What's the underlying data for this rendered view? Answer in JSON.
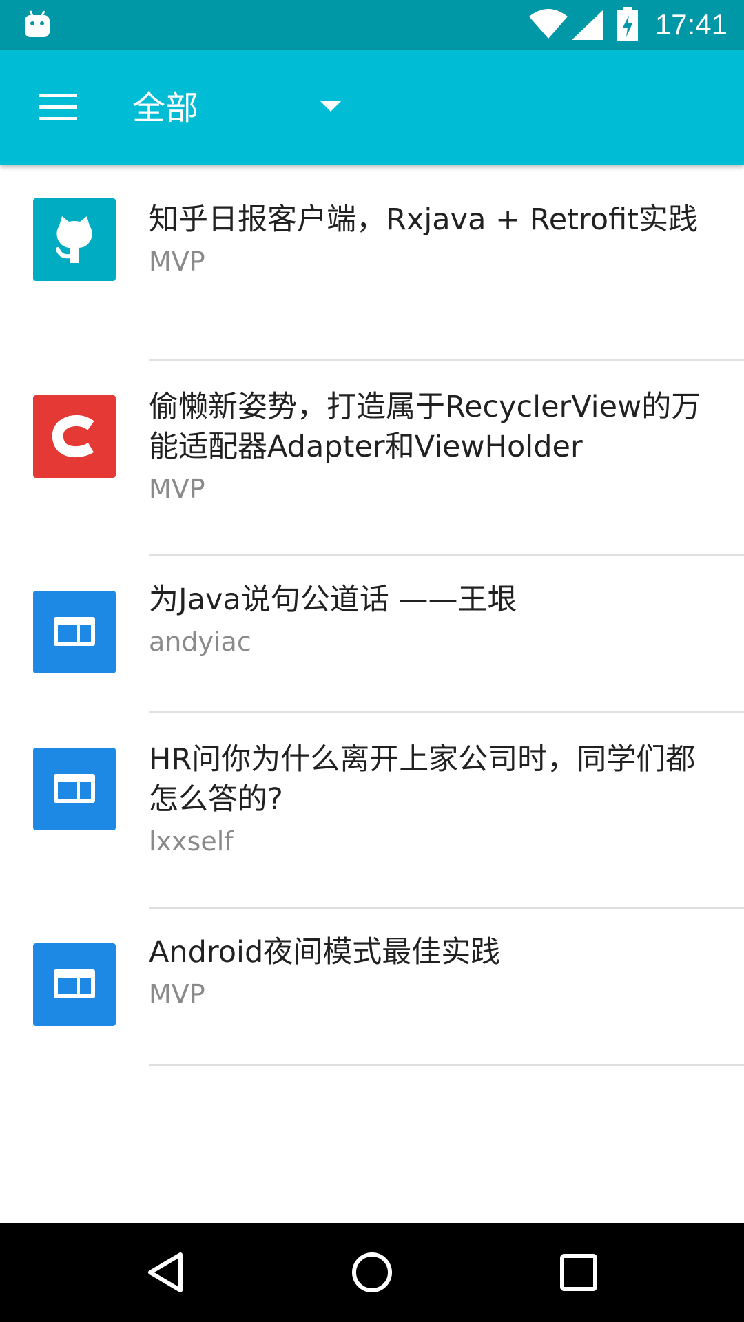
{
  "status_bar": {
    "time": "17:41",
    "icons": [
      "android-icon",
      "wifi-icon",
      "signal-icon",
      "battery-charging-icon"
    ]
  },
  "app_bar": {
    "menu_icon": "menu-icon",
    "category": "全部",
    "dropdown_icon": "arrow-drop-down-icon",
    "color": "#00bcd4",
    "status_color": "#0097a7"
  },
  "items": [
    {
      "title": "知乎日报客户端，Rxjava + Retrofit实践",
      "author": "MVP",
      "icon": "github-icon",
      "icon_color": "#00acc1"
    },
    {
      "title": "偷懒新姿势，打造属于RecyclerView的万能适配器Adapter和ViewHolder",
      "author": "MVP",
      "icon": "csdn-icon",
      "icon_color": "#e53935"
    },
    {
      "title": "为Java说句公道话 ——王垠",
      "author": "andyiac",
      "icon": "web-icon",
      "icon_color": "#1e88e5"
    },
    {
      "title": "HR问你为什么离开上家公司时，同学们都怎么答的?",
      "author": "lxxself",
      "icon": "web-icon",
      "icon_color": "#1e88e5"
    },
    {
      "title": "Android夜间模式最佳实践",
      "author": "MVP",
      "icon": "web-icon",
      "icon_color": "#1e88e5"
    }
  ],
  "nav_bar": {
    "buttons": [
      "back-icon",
      "home-icon",
      "recents-icon"
    ]
  }
}
